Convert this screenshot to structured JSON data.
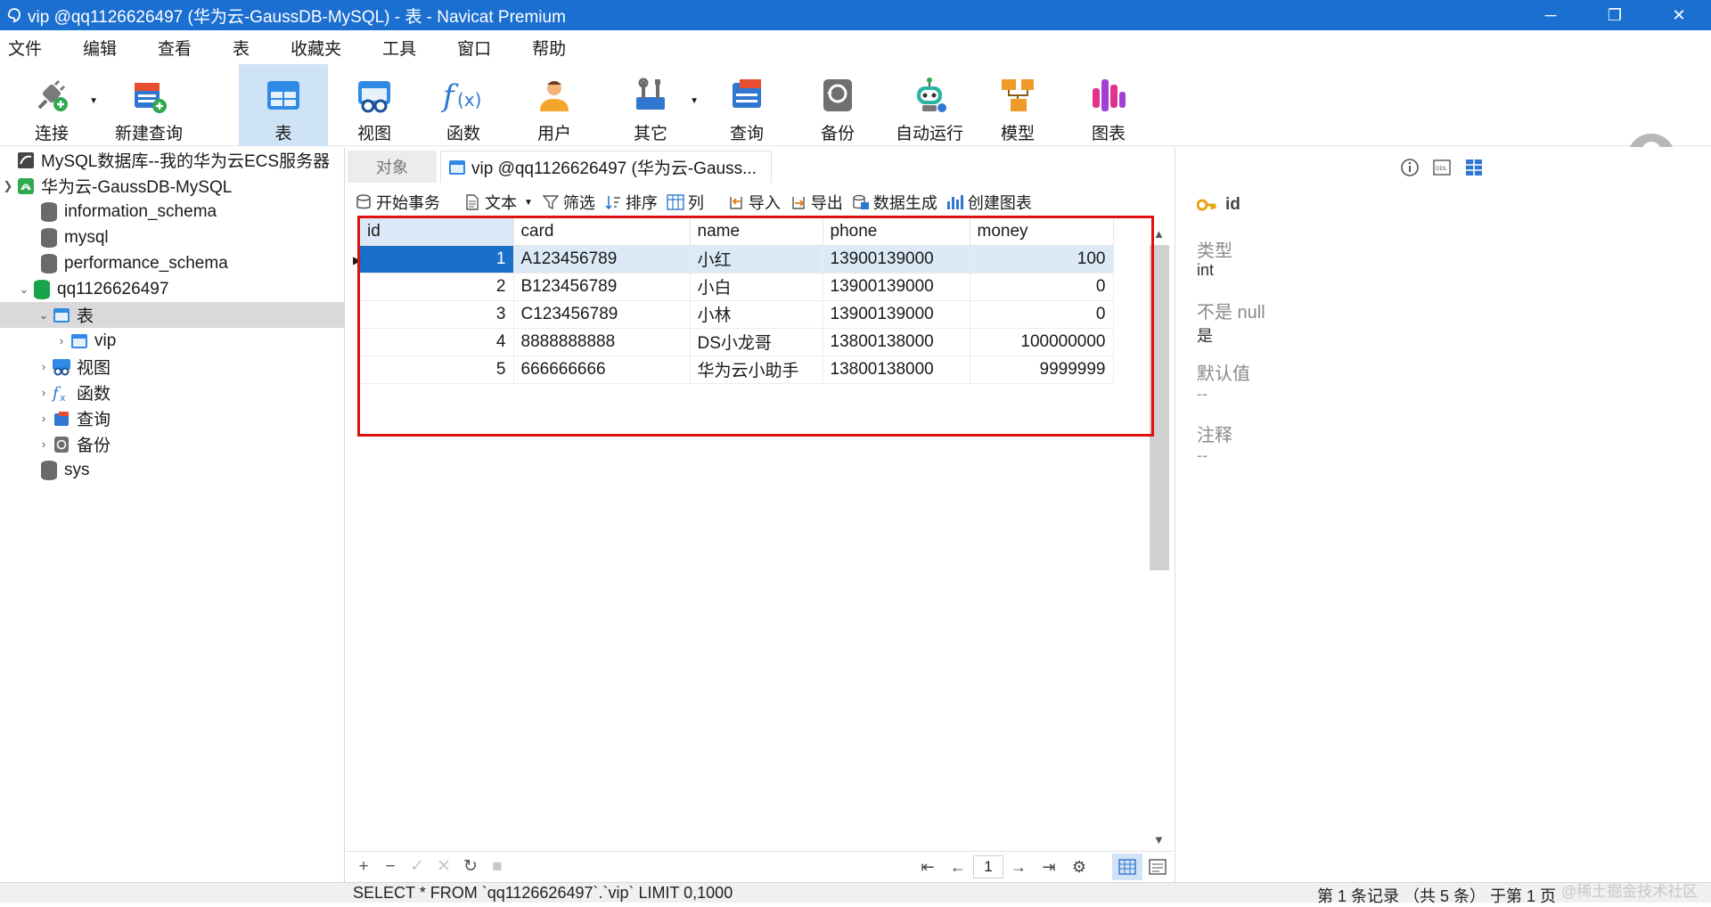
{
  "window": {
    "title": "vip @qq1126626497 (华为云-GaussDB-MySQL) - 表 - Navicat Premium",
    "minimize": "─",
    "restore": "❐",
    "close": "✕"
  },
  "menu": [
    "文件",
    "编辑",
    "查看",
    "表",
    "收藏夹",
    "工具",
    "窗口",
    "帮助"
  ],
  "toolbar": {
    "connect": "连接",
    "new_query": "新建查询",
    "table": "表",
    "view": "视图",
    "function": "函数",
    "user": "用户",
    "other": "其它",
    "query": "查询",
    "backup": "备份",
    "automation": "自动运行",
    "model": "模型",
    "chart": "图表"
  },
  "tree": {
    "conn1": "MySQL数据库--我的华为云ECS服务器",
    "conn2": "华为云-GaussDB-MySQL",
    "db1": "information_schema",
    "db2": "mysql",
    "db3": "performance_schema",
    "db4": "qq1126626497",
    "tables": "表",
    "vip": "vip",
    "views": "视图",
    "functions": "函数",
    "queries": "查询",
    "backups": "备份",
    "db5": "sys"
  },
  "tabs": {
    "objects": "对象",
    "active": "vip @qq1126626497 (华为云-Gauss..."
  },
  "tablebar": {
    "begin_tx": "开始事务",
    "text": "文本",
    "filter": "筛选",
    "sort": "排序",
    "columns": "列",
    "import": "导入",
    "export": "导出",
    "data_gen": "数据生成",
    "create_chart": "创建图表"
  },
  "grid": {
    "columns": [
      "id",
      "card",
      "name",
      "phone",
      "money"
    ],
    "rows": [
      [
        "1",
        "A123456789",
        "小红",
        "13900139000",
        "100"
      ],
      [
        "2",
        "B123456789",
        "小白",
        "13900139000",
        "0"
      ],
      [
        "3",
        "C123456789",
        "小林",
        "13900139000",
        "0"
      ],
      [
        "4",
        "8888888888",
        "DS小龙哥",
        "13800138000",
        "100000000"
      ],
      [
        "5",
        "666666666",
        "华为云小助手",
        "13800138000",
        "9999999"
      ]
    ]
  },
  "pager": {
    "page": "1"
  },
  "properties": {
    "field": "id",
    "type_label": "类型",
    "type_value": "int",
    "notnull_label": "不是 null",
    "notnull_value": "是",
    "default_label": "默认值",
    "default_value": "--",
    "comment_label": "注释",
    "comment_value": "--"
  },
  "status": {
    "sql": "SELECT * FROM `qq1126626497`.`vip` LIMIT 0,1000",
    "records": "第 1 条记录 （共 5 条） 于第 1 页",
    "watermark": "@稀土掘金技术社区"
  }
}
